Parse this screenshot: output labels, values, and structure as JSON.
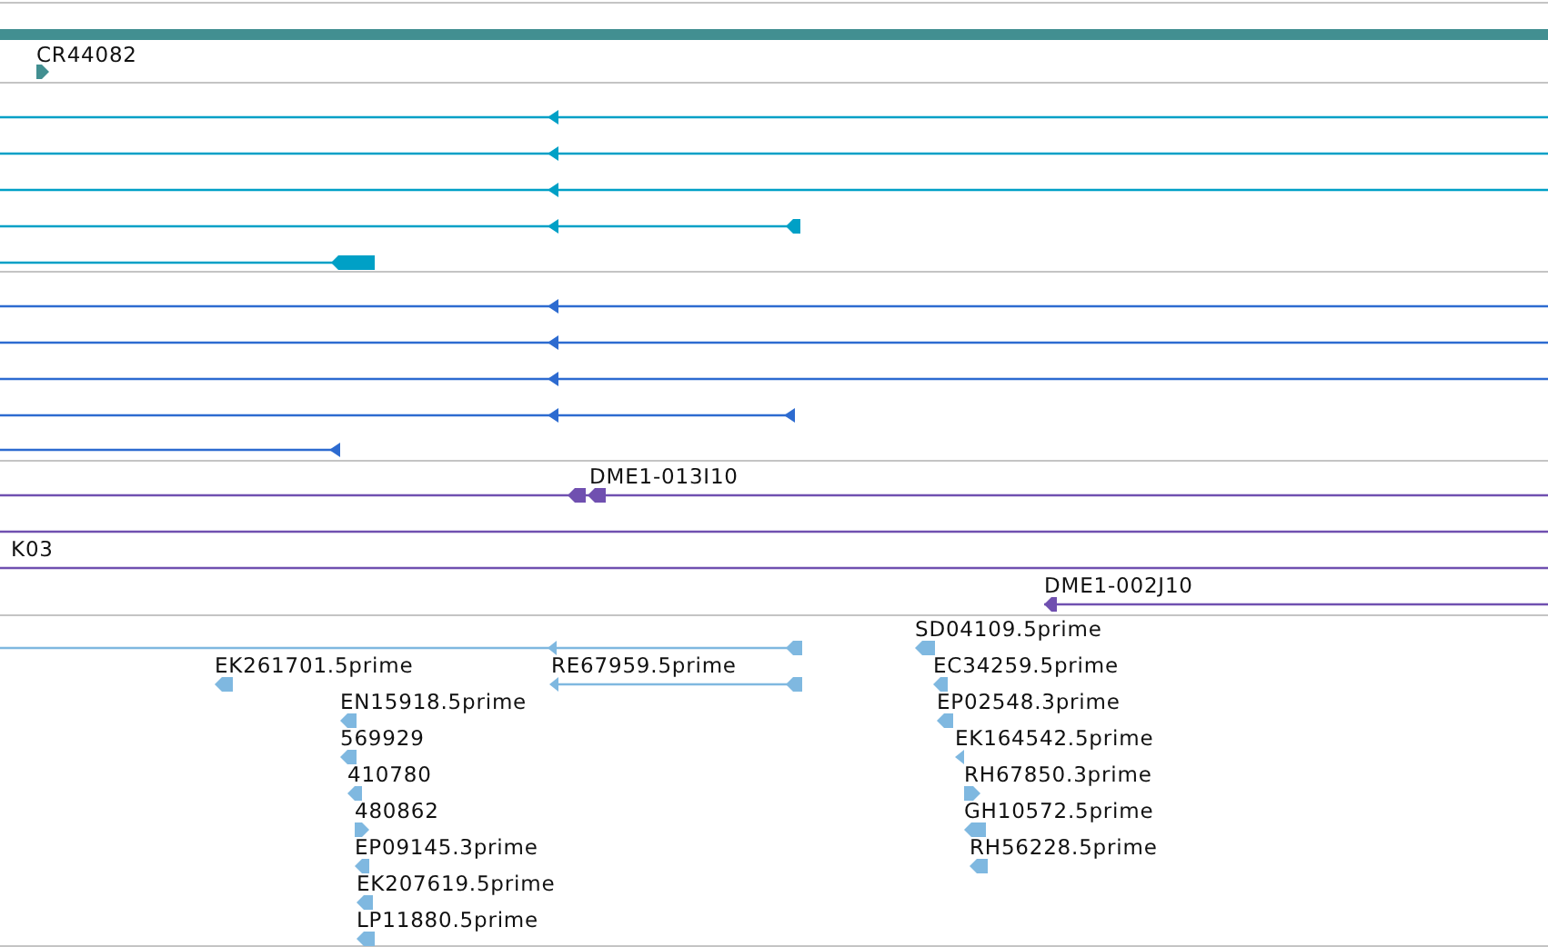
{
  "tracks": [
    {
      "color": "#428f91",
      "features": [
        {
          "kind": "bar"
        },
        {
          "kind": "transcript",
          "label": "CR44082",
          "reverse": false
        }
      ]
    },
    {
      "color": "#00a0c6",
      "features": [
        {
          "kind": "transcript",
          "reverse": true
        },
        {
          "kind": "transcript",
          "reverse": true
        },
        {
          "kind": "transcript",
          "reverse": true
        },
        {
          "kind": "transcript",
          "reverse": true
        },
        {
          "kind": "transcript",
          "reverse": true
        }
      ]
    },
    {
      "color": "#2d6bd0",
      "features": [
        {
          "kind": "transcript",
          "reverse": true
        },
        {
          "kind": "transcript",
          "reverse": true
        },
        {
          "kind": "transcript",
          "reverse": true
        },
        {
          "kind": "transcript",
          "reverse": true
        },
        {
          "kind": "transcript",
          "reverse": true
        }
      ]
    },
    {
      "color": "#7050b0",
      "features": [
        {
          "kind": "transcript",
          "label": "DME1-013I10",
          "reverse": true
        },
        {
          "kind": "transcript"
        },
        {
          "kind": "transcript",
          "label": "K03"
        },
        {
          "kind": "transcript",
          "label": "DME1-002J10",
          "reverse": true
        }
      ]
    },
    {
      "color": "#7fb8e0",
      "features": [
        {
          "kind": "transcript",
          "reverse": true
        },
        {
          "kind": "transcript",
          "label": "SD04109.5prime",
          "reverse": true
        },
        {
          "kind": "transcript",
          "label": "EK261701.5prime",
          "reverse": true
        },
        {
          "kind": "transcript",
          "label": "RE67959.5prime",
          "reverse": true
        },
        {
          "kind": "transcript",
          "label": "EC34259.5prime",
          "reverse": true
        },
        {
          "kind": "transcript",
          "label": "EN15918.5prime",
          "reverse": true
        },
        {
          "kind": "transcript",
          "label": "EP02548.3prime",
          "reverse": true
        },
        {
          "kind": "transcript",
          "label": "569929",
          "reverse": true
        },
        {
          "kind": "transcript",
          "label": "EK164542.5prime",
          "reverse": true
        },
        {
          "kind": "transcript",
          "label": "410780",
          "reverse": true
        },
        {
          "kind": "transcript",
          "label": "RH67850.3prime",
          "reverse": false
        },
        {
          "kind": "transcript",
          "label": "480862",
          "reverse": false
        },
        {
          "kind": "transcript",
          "label": "GH10572.5prime",
          "reverse": true
        },
        {
          "kind": "transcript",
          "label": "EP09145.3prime",
          "reverse": true
        },
        {
          "kind": "transcript",
          "label": "RH56228.5prime",
          "reverse": true
        },
        {
          "kind": "transcript",
          "label": "EK207619.5prime",
          "reverse": true
        },
        {
          "kind": "transcript",
          "label": "LP11880.5prime",
          "reverse": true
        }
      ]
    }
  ]
}
